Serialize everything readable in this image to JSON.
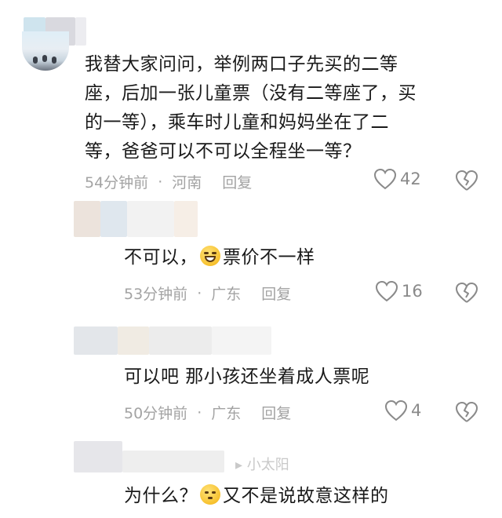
{
  "comments": [
    {
      "text_lines": [
        "我替大家问问，举例两口子先买的二等",
        "座，后加一张儿童票（没有二等座了，买",
        "的一等），乘车时儿童和妈妈坐在了二",
        "等，爸爸可以不可以全程坐一等？"
      ],
      "time": "54分钟前",
      "separator": "·",
      "location": "河南",
      "reply_label": "回复",
      "likes": "42"
    },
    {
      "text_before": "不可以，",
      "emoji": "laugh-sweat-emoji",
      "text_after": "票价不一样",
      "time": "53分钟前",
      "separator": "·",
      "location": "广东",
      "reply_label": "回复",
      "likes": "16"
    },
    {
      "text": "可以吧 那小孩还坐着成人票呢",
      "time": "50分钟前",
      "separator": "·",
      "location": "广东",
      "reply_label": "回复",
      "likes": "4"
    },
    {
      "reply_header_partial": "小太阳",
      "text_before": "为什么？",
      "emoji": "thinking-emoji",
      "text_after": "又不是说故意这样的"
    }
  ],
  "colors": {
    "text": "#1a1a1a",
    "meta": "#a3a3a3",
    "icon": "#8a8a8a"
  }
}
